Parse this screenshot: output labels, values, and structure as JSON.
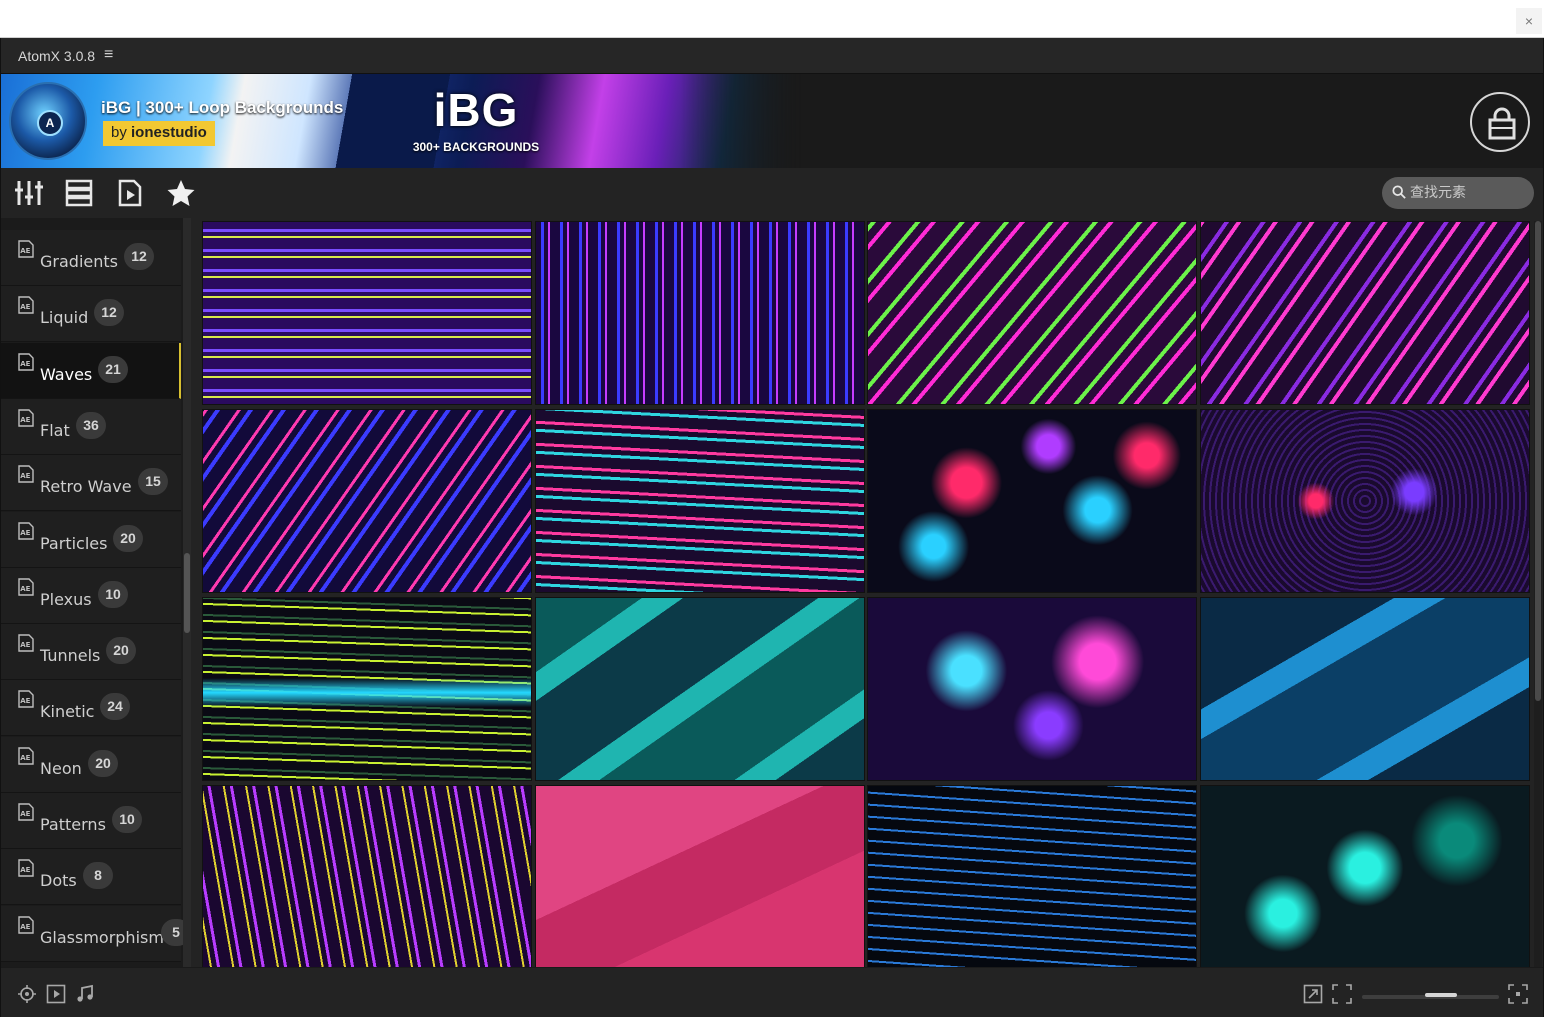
{
  "window": {
    "close_glyph": "×"
  },
  "app": {
    "title": "AtomX 3.0.8",
    "menu_glyph": "≡"
  },
  "banner": {
    "title": "iBG | 300+ Loop Backgrounds",
    "author_prefix": "by",
    "author": "ionestudio",
    "logo_letter": "A",
    "brand_text": "iBG",
    "brand_sub": "300+ BACKGROUNDS"
  },
  "toolbar": {
    "icons": [
      "sliders-icon",
      "list-view-icon",
      "preview-file-icon",
      "star-icon"
    ],
    "search_placeholder": "查找元素"
  },
  "sidebar": {
    "active": "Waves",
    "items": [
      {
        "label": "Gradients",
        "count": "12"
      },
      {
        "label": "Liquid",
        "count": "12"
      },
      {
        "label": "Waves",
        "count": "21"
      },
      {
        "label": "Flat",
        "count": "36"
      },
      {
        "label": "Retro Wave",
        "count": "15"
      },
      {
        "label": "Particles",
        "count": "20"
      },
      {
        "label": "Plexus",
        "count": "10"
      },
      {
        "label": "Tunnels",
        "count": "20"
      },
      {
        "label": "Kinetic",
        "count": "24"
      },
      {
        "label": "Neon",
        "count": "20"
      },
      {
        "label": "Patterns",
        "count": "10"
      },
      {
        "label": "Dots",
        "count": "8"
      },
      {
        "label": "Glassmorphism",
        "count": "5"
      }
    ]
  },
  "thumbnails": [
    {
      "style": "neon-horizontal-lines",
      "colors": [
        "#2a0a5e",
        "#d9e84a",
        "#7a4cff"
      ]
    },
    {
      "style": "neon-vertical-lines",
      "colors": [
        "#1a0740",
        "#3b3bff",
        "#c53cff"
      ]
    },
    {
      "style": "diagonal-pink-green",
      "colors": [
        "#2a0a3a",
        "#ff2bd6",
        "#6cf24a"
      ]
    },
    {
      "style": "diagonal-magenta",
      "colors": [
        "#200a30",
        "#ff3ad0",
        "#8a2be2"
      ]
    },
    {
      "style": "diagonal-blue-pink",
      "colors": [
        "#120a3a",
        "#3b3bff",
        "#ff3ab0"
      ]
    },
    {
      "style": "horizontal-waves",
      "colors": [
        "#1a0a2e",
        "#2fd6e0",
        "#ff3aa0"
      ]
    },
    {
      "style": "liquid-web",
      "colors": [
        "#0a0a1a",
        "#ff2a6a",
        "#2ad0ff"
      ]
    },
    {
      "style": "liquid-dense",
      "colors": [
        "#1a0a2e",
        "#7a3cff",
        "#ff2a6a"
      ]
    },
    {
      "style": "wavy-neon-horizontal",
      "colors": [
        "#0a0a14",
        "#c8f032",
        "#24d8ff"
      ]
    },
    {
      "style": "teal-waves",
      "colors": [
        "#0c3a48",
        "#1fb5b0",
        "#0a5a5a"
      ]
    },
    {
      "style": "fractal-swirl",
      "colors": [
        "#1a0a3a",
        "#4ae0ff",
        "#ff4ad8"
      ]
    },
    {
      "style": "blue-waves",
      "colors": [
        "#0a2a45",
        "#1e8fd0",
        "#0b3f66"
      ]
    },
    {
      "style": "vertical-wavy-lines",
      "colors": [
        "#1a0730",
        "#e0d030",
        "#b83cff"
      ]
    },
    {
      "style": "pink-flat",
      "colors": [
        "#d8356f",
        "#c42a62",
        "#e04582"
      ]
    },
    {
      "style": "blue-line-waves",
      "colors": [
        "#05080f",
        "#2a7ad8",
        "#143a6a"
      ]
    },
    {
      "style": "cyan-liquid",
      "colors": [
        "#0a1a20",
        "#2af0e0",
        "#0a8a7a"
      ]
    }
  ],
  "bottombar": {
    "left_icons": [
      "target-icon",
      "play-icon",
      "music-icon"
    ],
    "right_icons": [
      "expand-icon",
      "fit-icon",
      "fullscreen-icon"
    ],
    "zoom_level": 0.6
  }
}
